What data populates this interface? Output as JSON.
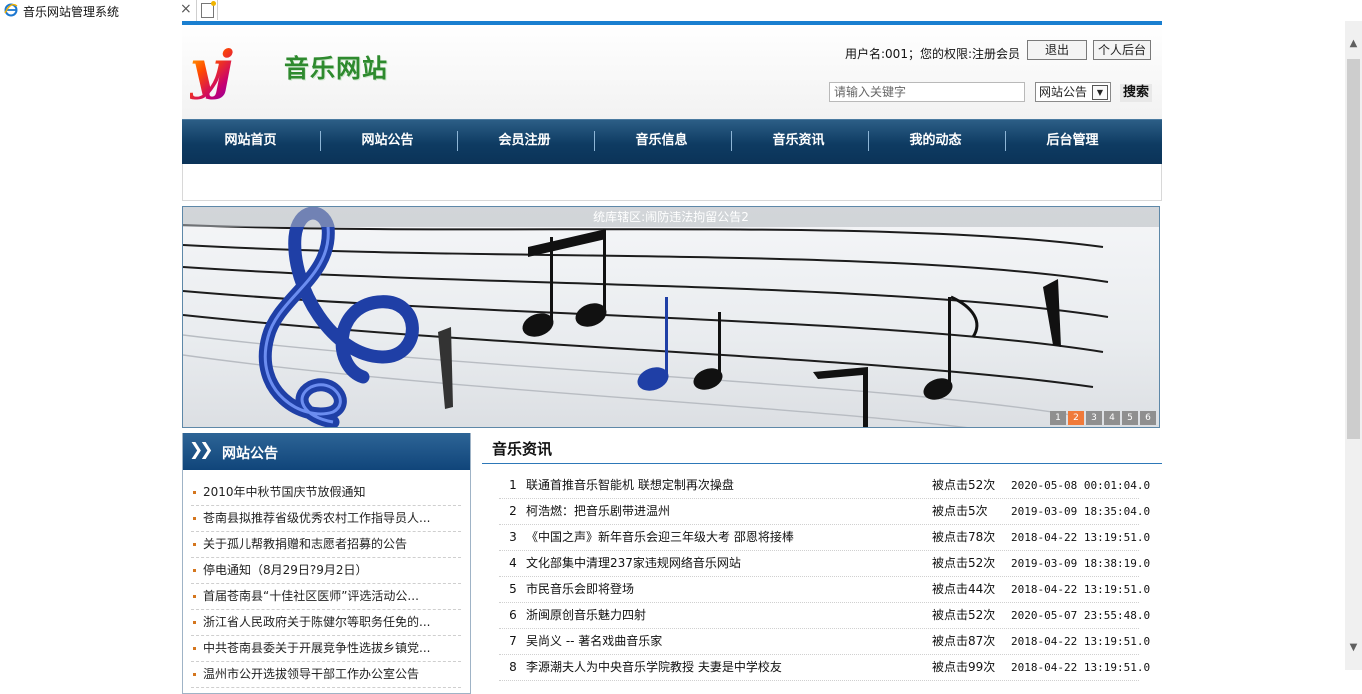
{
  "browser": {
    "tab_title": "音乐网站管理系统",
    "tab_close": "×"
  },
  "header": {
    "logo_mark": "yj",
    "site_name": "音乐网站",
    "user_info": "用户名:001；您的权限:注册会员",
    "logout_label": "退出",
    "admin_label": "个人后台",
    "search_placeholder": "请输入关键字",
    "search_scope": "网站公告",
    "search_label": "搜索"
  },
  "nav": {
    "items": [
      "网站首页",
      "网站公告",
      "会员注册",
      "音乐信息",
      "音乐资讯",
      "我的动态",
      "后台管理"
    ]
  },
  "banner": {
    "caption": "统库辖区:闹防违法拘留公告2",
    "pages": [
      "1",
      "2",
      "3",
      "4",
      "5",
      "6"
    ],
    "active_page": 2
  },
  "notice": {
    "title": "网站公告",
    "items": [
      "2010年中秋节国庆节放假通知",
      "苍南县拟推荐省级优秀农村工作指导员人...",
      "关于孤儿帮教捐赠和志愿者招募的公告",
      "停电通知（8月29日?9月2日）",
      "首届苍南县“十佳社区医师”评选活动公...",
      "浙江省人民政府关于陈健尔等职务任免的...",
      "中共苍南县委关于开展竞争性选拔乡镇党...",
      "温州市公开选拔领导干部工作办公室公告"
    ]
  },
  "news": {
    "title": "音乐资讯",
    "rows": [
      {
        "idx": "1",
        "title": "联通首推音乐智能机 联想定制再次操盘",
        "clicks": "被点击52次",
        "date": "2020-05-08 00:01:04.0"
      },
      {
        "idx": "2",
        "title": "柯浩燃：把音乐剧带进温州",
        "clicks": "被点击5次",
        "date": "2019-03-09 18:35:04.0"
      },
      {
        "idx": "3",
        "title": "《中国之声》新年音乐会迎三年级大考 邵恩将接棒",
        "clicks": "被点击78次",
        "date": "2018-04-22 13:19:51.0"
      },
      {
        "idx": "4",
        "title": "文化部集中清理237家违规网络音乐网站",
        "clicks": "被点击52次",
        "date": "2019-03-09 18:38:19.0"
      },
      {
        "idx": "5",
        "title": "市民音乐会即将登场",
        "clicks": "被点击44次",
        "date": "2018-04-22 13:19:51.0"
      },
      {
        "idx": "6",
        "title": "浙闽原创音乐魅力四射",
        "clicks": "被点击52次",
        "date": "2020-05-07 23:55:48.0"
      },
      {
        "idx": "7",
        "title": "吴尚义 -- 著名戏曲音乐家",
        "clicks": "被点击87次",
        "date": "2018-04-22 13:19:51.0"
      },
      {
        "idx": "8",
        "title": "李源潮夫人为中央音乐学院教授 夫妻是中学校友",
        "clicks": "被点击99次",
        "date": "2018-04-22 13:19:51.0"
      }
    ]
  },
  "colors": {
    "accent": "#1a7fd0",
    "nav_bg": "#0e3b62",
    "logo_green": "#2e8a2e",
    "pager_active": "#f07a3a"
  }
}
